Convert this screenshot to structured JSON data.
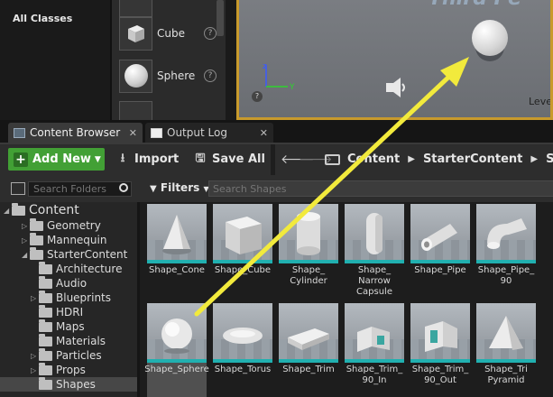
{
  "modes_panel": {
    "category": "All Classes",
    "items": [
      {
        "label": "Cube"
      },
      {
        "label": "Sphere"
      }
    ]
  },
  "viewport": {
    "overlay_text": "Third Pe",
    "corner_label": "Level"
  },
  "tabs": [
    {
      "label": "Content Browser"
    },
    {
      "label": "Output Log"
    }
  ],
  "toolbar": {
    "add_new": "Add New",
    "import": "Import",
    "save_all": "Save All"
  },
  "breadcrumb": [
    "Content",
    "StarterContent",
    "S"
  ],
  "sources": {
    "search_placeholder": "Search Folders",
    "tree": [
      {
        "label": "Content",
        "level": 0,
        "expanded": true
      },
      {
        "label": "Geometry",
        "level": 1,
        "expanded": false
      },
      {
        "label": "Mannequin",
        "level": 1,
        "expanded": false
      },
      {
        "label": "StarterContent",
        "level": 1,
        "expanded": true
      },
      {
        "label": "Architecture",
        "level": 2,
        "expanded": false
      },
      {
        "label": "Audio",
        "level": 2,
        "expanded": false
      },
      {
        "label": "Blueprints",
        "level": 2,
        "expanded": false
      },
      {
        "label": "HDRI",
        "level": 2,
        "expanded": false
      },
      {
        "label": "Maps",
        "level": 2,
        "expanded": false
      },
      {
        "label": "Materials",
        "level": 2,
        "expanded": false
      },
      {
        "label": "Particles",
        "level": 2,
        "expanded": false
      },
      {
        "label": "Props",
        "level": 2,
        "expanded": false
      },
      {
        "label": "Shapes",
        "level": 2,
        "expanded": false,
        "selected": true
      }
    ]
  },
  "assets": {
    "filters_label": "Filters",
    "search_placeholder": "Search Shapes",
    "tiles": [
      {
        "label": "Shape_Cone"
      },
      {
        "label": "Shape_Cube"
      },
      {
        "label": "Shape_ Cylinder"
      },
      {
        "label": "Shape_ Narrow Capsule"
      },
      {
        "label": "Shape_Pipe"
      },
      {
        "label": "Shape_Pipe_ 90"
      },
      {
        "label": "Shape_Sphere",
        "selected": true
      },
      {
        "label": "Shape_Torus"
      },
      {
        "label": "Shape_Trim"
      },
      {
        "label": "Shape_Trim_ 90_In"
      },
      {
        "label": "Shape_Trim_ 90_Out"
      },
      {
        "label": "Shape_Tri Pyramid"
      }
    ]
  },
  "annotation": {
    "arrow_color": "#f2ea3c"
  },
  "colors": {
    "accent_green": "#42a035",
    "viewport_border": "#c89a2c",
    "tile_underline": "#21b0b0"
  }
}
